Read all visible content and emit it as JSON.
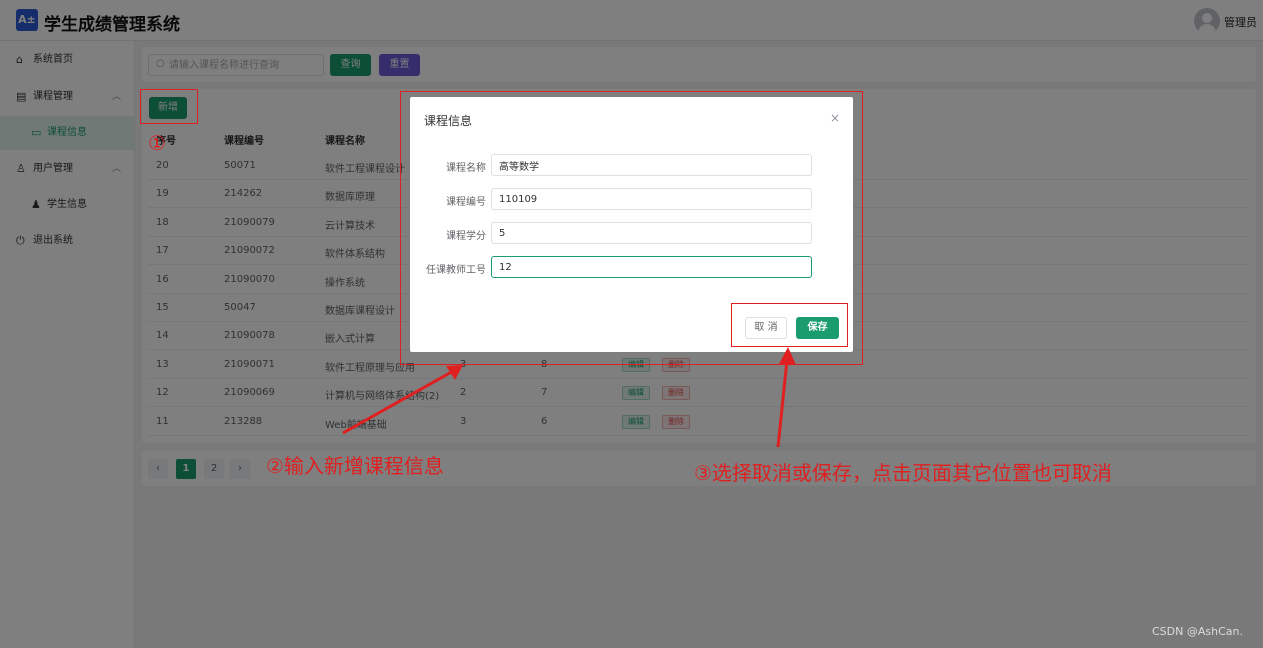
{
  "app": {
    "logo_text": "A±",
    "title": "学生成绩管理系统"
  },
  "header": {
    "user_name": "管理员"
  },
  "sidebar": {
    "items": [
      {
        "label": "系统首页",
        "icon": "home-icon"
      },
      {
        "label": "课程管理",
        "icon": "book-icon"
      },
      {
        "label": "课程信息",
        "icon": "document-icon"
      },
      {
        "label": "用户管理",
        "icon": "user-icon"
      },
      {
        "label": "学生信息",
        "icon": "person-icon"
      },
      {
        "label": "退出系统",
        "icon": "power-icon"
      }
    ]
  },
  "search": {
    "placeholder": "请输入课程名称进行查询",
    "query_label": "查询",
    "reset_label": "重置"
  },
  "toolbar": {
    "add_label": "新增"
  },
  "table": {
    "headers": [
      "序号",
      "课程编号",
      "课程名称"
    ],
    "rows": [
      {
        "id": "20",
        "code": "50071",
        "name": "软件工程课程设计",
        "credit": "",
        "teacher": ""
      },
      {
        "id": "19",
        "code": "214262",
        "name": "数据库原理",
        "credit": "",
        "teacher": ""
      },
      {
        "id": "18",
        "code": "21090079",
        "name": "云计算技术",
        "credit": "",
        "teacher": ""
      },
      {
        "id": "17",
        "code": "21090072",
        "name": "软件体系结构",
        "credit": "",
        "teacher": ""
      },
      {
        "id": "16",
        "code": "21090070",
        "name": "操作系统",
        "credit": "",
        "teacher": ""
      },
      {
        "id": "15",
        "code": "50047",
        "name": "数据库课程设计",
        "credit": "",
        "teacher": ""
      },
      {
        "id": "14",
        "code": "21090078",
        "name": "嵌入式计算",
        "credit": "",
        "teacher": ""
      },
      {
        "id": "13",
        "code": "21090071",
        "name": "软件工程原理与应用",
        "credit": "3",
        "teacher": "8"
      },
      {
        "id": "12",
        "code": "21090069",
        "name": "计算机与网络体系结构(2)",
        "credit": "2",
        "teacher": "7"
      },
      {
        "id": "11",
        "code": "213288",
        "name": "Web前端基础",
        "credit": "3",
        "teacher": "6"
      }
    ],
    "edit_label": "编辑",
    "delete_label": "删除"
  },
  "pagination": {
    "prev": "‹",
    "pages": [
      "1",
      "2"
    ],
    "current": "1",
    "next": "›"
  },
  "dialog": {
    "title": "课程信息",
    "close": "×",
    "fields": [
      {
        "label": "课程名称",
        "value": "高等数学"
      },
      {
        "label": "课程编号",
        "value": "110109"
      },
      {
        "label": "课程学分",
        "value": "5"
      },
      {
        "label": "任课教师工号",
        "value": "12"
      }
    ],
    "cancel_label": "取 消",
    "save_label": "保存"
  },
  "annotations": {
    "step1": "①",
    "step2": "②输入新增课程信息",
    "step3": "③选择取消或保存，点击页面其它位置也可取消"
  },
  "watermark": "CSDN @AshCan.",
  "colors": {
    "accent": "#1a9c6e",
    "purple": "#6b5bd9",
    "annotation_red": "#e02020",
    "danger": "#e04a4a"
  }
}
